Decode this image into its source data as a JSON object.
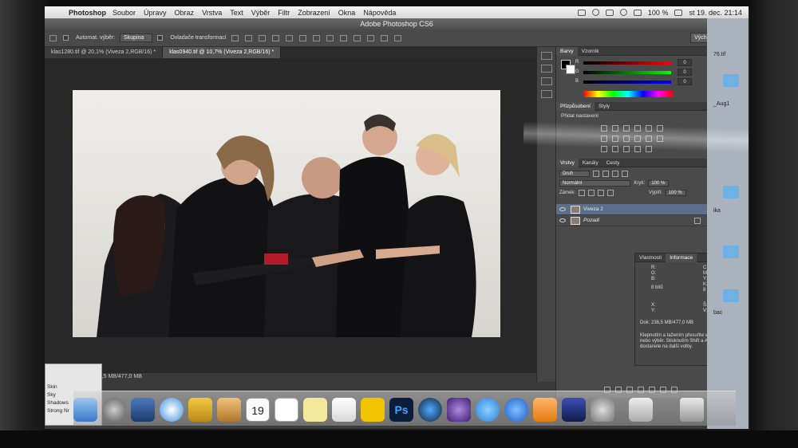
{
  "menubar": {
    "app_name": "Photoshop",
    "items": [
      "Soubor",
      "Úpravy",
      "Obraz",
      "Vrstva",
      "Text",
      "Výběr",
      "Filtr",
      "Zobrazení",
      "Okna",
      "Nápověda"
    ],
    "battery": "100 %",
    "datetime": "st 19. dec. 21:14"
  },
  "window": {
    "title": "Adobe Photoshop CS6"
  },
  "options_bar": {
    "auto_select_label": "Automat. výběr:",
    "auto_select_value": "Skupina",
    "transform_controls_label": "Ovladače transformací",
    "workspace": "Výchozí"
  },
  "doc_tabs": [
    {
      "label": "klas1280.tif @ 20,1% (Viveza 2,RGB/16) *"
    },
    {
      "label": "klas0940.tif @ 10,7% (Viveza 2,RGB/16) *"
    }
  ],
  "status": {
    "doc_size": "238,5 MB/477,0 MB"
  },
  "color_panel": {
    "tabs": [
      "Barvy",
      "Vzorník"
    ],
    "channels": [
      {
        "label": "R",
        "value": "0"
      },
      {
        "label": "G",
        "value": "0"
      },
      {
        "label": "B",
        "value": "0"
      }
    ]
  },
  "adjustments_panel": {
    "tabs": [
      "Přizpůsobení",
      "Styly"
    ],
    "heading": "Přidat nastavení"
  },
  "layers_panel": {
    "tabs": [
      "Vrstvy",
      "Kanály",
      "Cesty"
    ],
    "filter_kind": "Druh",
    "blend_mode": "Normální",
    "opacity_label": "Krytí:",
    "opacity_value": "100 %",
    "lock_label": "Zámek:",
    "fill_label": "Výplň:",
    "fill_value": "100 %",
    "layers": [
      {
        "name": "Viveza 2",
        "selected": true
      },
      {
        "name": "Pozadí",
        "selected": false
      }
    ]
  },
  "info_panel": {
    "tabs": [
      "Vlastnosti",
      "Informace"
    ],
    "rgb": [
      "R:",
      "G:",
      "B:"
    ],
    "cmyk": [
      "C:",
      "M:",
      "Y:",
      "K:"
    ],
    "bits_left": "8 bitů",
    "bits_right": "8 bitů",
    "xy": [
      "X:",
      "Y:"
    ],
    "wh": [
      "Š:",
      "V:"
    ],
    "doc_info": "Dok: 238,5 MB/477,0 MB",
    "hint": "Klepnutím a tažením přesuňte vrstvu nebo výběr. Stisknutím Shift a Alt se dostanete na další volby."
  },
  "mini_palette": {
    "items": [
      "Skin",
      "Sky",
      "Shadows",
      "Strong Nr"
    ]
  },
  "finder": {
    "labels": [
      "76.tif",
      "_Aug1",
      "ika",
      "bac"
    ]
  },
  "dock": {
    "calendar_day": "19",
    "photoshop_label": "Ps"
  },
  "colors": {
    "menubar": "#e6e6e6",
    "panel": "#4a4a4a",
    "selected_layer": "#5b6f8b",
    "canvas_bg": "#282828"
  }
}
